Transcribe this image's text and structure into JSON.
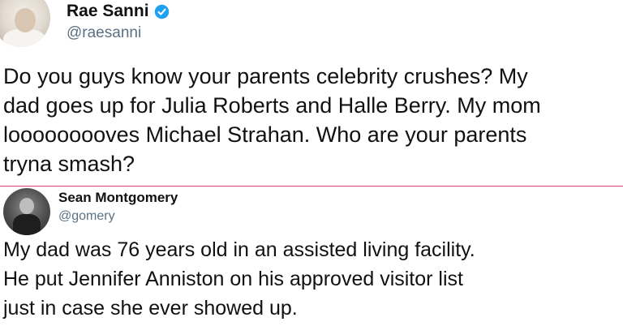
{
  "tweet1": {
    "author_name": "Rae Sanni",
    "handle": "@raesanni",
    "verified_icon": "verified-badge-icon",
    "verified_color": "#1da1f2",
    "text_lines": [
      "Do you guys know your parents celebrity crushes? My",
      "dad goes up for Julia Roberts and Halle Berry. My mom",
      "looooooooves Michael Strahan. Who are your parents",
      "tryna smash?"
    ]
  },
  "divider_color": "#e0245e",
  "tweet2": {
    "author_name": "Sean Montgomery",
    "handle": "@gomery",
    "text_lines": [
      "My dad was 76 years old in an assisted living facility.",
      "He put Jennifer Anniston on his approved visitor list",
      "just in case she ever showed up."
    ]
  }
}
